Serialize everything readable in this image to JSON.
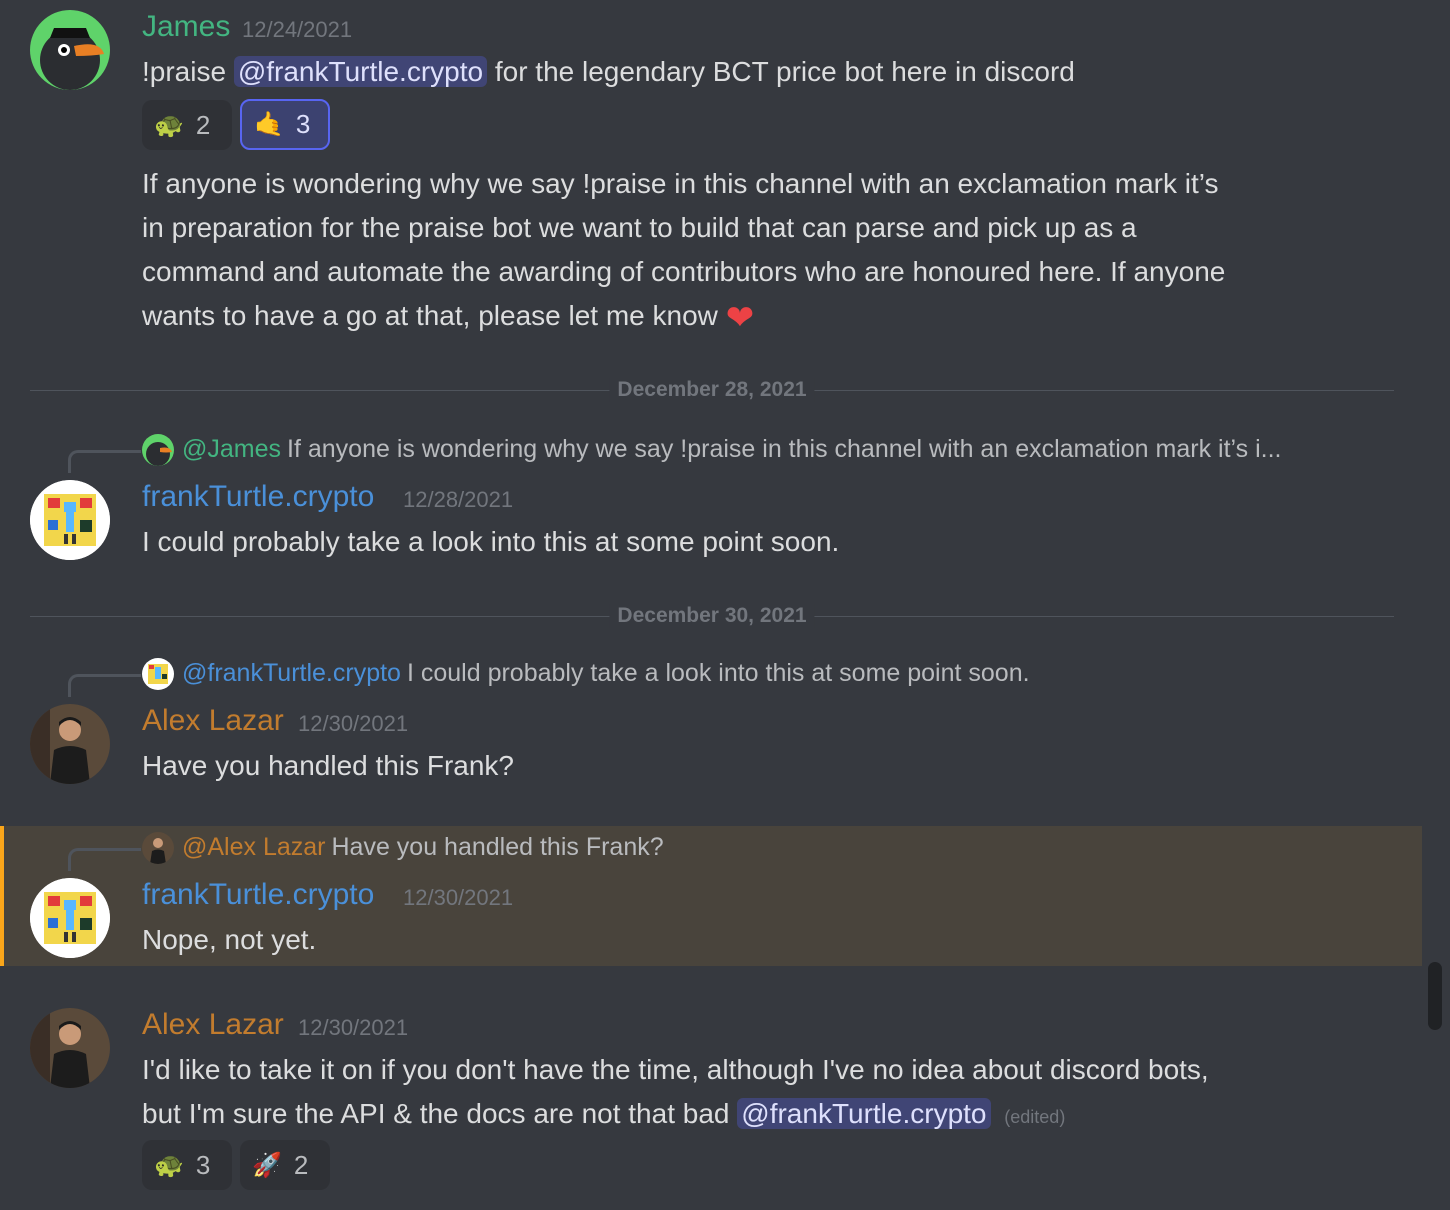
{
  "colors": {
    "background": "#36393f",
    "james": "#43b581",
    "frank": "#4a90d9",
    "alex": "#c27c2e",
    "mention_bg": "#414675",
    "highlight_border": "#faa61a"
  },
  "messages": {
    "m1": {
      "author": "James",
      "timestamp": "12/24/2021",
      "line1_pre": "!praise ",
      "line1_mention": "@frankTurtle.crypto",
      "line1_post": " for the legendary BCT price bot here in discord",
      "reactions": [
        {
          "emoji": "🐢",
          "count": "2"
        },
        {
          "emoji": "🤙",
          "count": "3"
        }
      ],
      "para_lines": [
        "If anyone is wondering why we say !praise in this channel with an exclamation mark it’s",
        "in preparation for the praise bot we want to build that can parse and pick up as a",
        "command and automate the awarding of contributors who are honoured here. If anyone",
        "wants to have a go at that, please let me know"
      ],
      "heart": "❤"
    },
    "divider1": "December 28, 2021",
    "m2": {
      "reply_name": "@James",
      "reply_text": "If anyone is wondering why we say !praise in this channel with an exclamation mark it’s i...",
      "author": "frankTurtle.crypto",
      "timestamp": "12/28/2021",
      "text": "I could probably take a look into this at some point soon."
    },
    "divider2": "December 30, 2021",
    "m3": {
      "reply_name": "@frankTurtle.crypto",
      "reply_text": "I could probably take a look into this at some point soon.",
      "author": "Alex Lazar",
      "timestamp": "12/30/2021",
      "text": "Have you handled this Frank?"
    },
    "m4": {
      "reply_name": "@Alex Lazar",
      "reply_text": "Have you handled this Frank?",
      "author": "frankTurtle.crypto",
      "timestamp": "12/30/2021",
      "text": "Nope, not yet."
    },
    "m5": {
      "author": "Alex Lazar",
      "timestamp": "12/30/2021",
      "line1": "I'd like to take it on if you don't have the time, although I've no idea about discord bots,",
      "line2_pre": "but I'm sure the API & the docs are not that bad ",
      "line2_mention": "@frankTurtle.crypto",
      "edited": "(edited)",
      "reactions": [
        {
          "emoji": "🐢",
          "count": "3"
        },
        {
          "emoji": "🚀",
          "count": "2"
        }
      ]
    }
  }
}
